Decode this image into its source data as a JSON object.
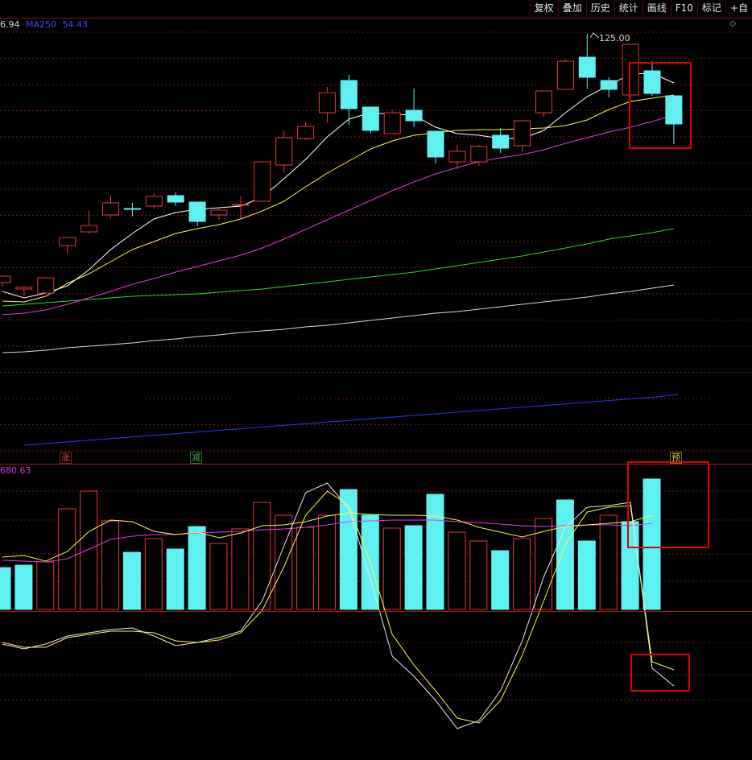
{
  "toolbar": {
    "items": [
      "复权",
      "叠加",
      "历史",
      "统计",
      "画线",
      "F10",
      "标记",
      "+自"
    ]
  },
  "ma_legend": {
    "prev_value": "6.94",
    "ma250_label": "MA250",
    "ma250_value": "54.43"
  },
  "volume_legend": {
    "value": "680.63"
  },
  "price_marker": {
    "high_label": "125.00"
  },
  "event_tags": [
    {
      "text": "涨",
      "color": "#e04040"
    },
    {
      "text": "减",
      "color": "#4caf50"
    },
    {
      "text": "预",
      "color": "#e8c84a"
    }
  ],
  "colors": {
    "up": "#e23a3a",
    "down": "#5ff1f1",
    "ma5": "#ffffff",
    "ma10": "#f6f64a",
    "ma20": "#e23ae2",
    "ma60": "#2ed62e",
    "ma120": "#d8d8d8",
    "ma250": "#2a3af0",
    "highlight_box": "#e00000",
    "grid": "#7a1414"
  },
  "chart_data": {
    "type": "candlestick",
    "candles": [
      {
        "o": 351,
        "c": 343,
        "h": 343,
        "l": 356
      },
      {
        "o": 359,
        "c": 357,
        "h": 355,
        "l": 368
      },
      {
        "o": 364,
        "c": 345,
        "h": 345,
        "l": 364
      },
      {
        "o": 305,
        "c": 295,
        "h": 295,
        "l": 315
      },
      {
        "o": 288,
        "c": 280,
        "h": 262,
        "l": 290
      },
      {
        "o": 267,
        "c": 252,
        "h": 242,
        "l": 271
      },
      {
        "o": 259,
        "c": 259,
        "h": 252,
        "l": 269
      },
      {
        "o": 256,
        "c": 244,
        "h": 240,
        "l": 259
      },
      {
        "o": 243,
        "c": 251,
        "h": 239,
        "l": 256
      },
      {
        "o": 251,
        "c": 275,
        "h": 251,
        "l": 281
      },
      {
        "o": 267,
        "c": 261,
        "h": 258,
        "l": 273
      },
      {
        "o": 255,
        "c": 254,
        "h": 244,
        "l": 271
      },
      {
        "o": 250,
        "c": 201,
        "h": 201,
        "l": 250
      },
      {
        "o": 205,
        "c": 171,
        "h": 162,
        "l": 214
      },
      {
        "o": 172,
        "c": 157,
        "h": 151,
        "l": 174
      },
      {
        "o": 140,
        "c": 115,
        "h": 108,
        "l": 152
      },
      {
        "o": 100,
        "c": 135,
        "h": 93,
        "l": 155
      },
      {
        "o": 133,
        "c": 162,
        "h": 133,
        "l": 166
      },
      {
        "o": 166,
        "c": 140,
        "h": 137,
        "l": 166
      },
      {
        "o": 137,
        "c": 150,
        "h": 110,
        "l": 158
      },
      {
        "o": 163,
        "c": 195,
        "h": 163,
        "l": 203
      },
      {
        "o": 201,
        "c": 188,
        "h": 180,
        "l": 210
      },
      {
        "o": 201,
        "c": 182,
        "h": 180,
        "l": 206
      },
      {
        "o": 168,
        "c": 184,
        "h": 159,
        "l": 190
      },
      {
        "o": 181,
        "c": 150,
        "h": 150,
        "l": 189
      },
      {
        "o": 140,
        "c": 113,
        "h": 113,
        "l": 145
      },
      {
        "o": 111,
        "c": 76,
        "h": 74,
        "l": 111
      },
      {
        "o": 71,
        "c": 96,
        "h": 42,
        "l": 110
      },
      {
        "o": 100,
        "c": 111,
        "h": 96,
        "l": 121
      },
      {
        "o": 118,
        "c": 55,
        "h": 55,
        "l": 122
      },
      {
        "o": 88,
        "c": 116,
        "h": 76,
        "l": 119
      },
      {
        "o": 119,
        "c": 154,
        "h": 119,
        "l": 179
      }
    ],
    "ma5": [
      362,
      370,
      364,
      355,
      335,
      310,
      290,
      272,
      264,
      260,
      258,
      256,
      245,
      222,
      198,
      170,
      148,
      140,
      142,
      143,
      158,
      166,
      168,
      172,
      172,
      162,
      140,
      120,
      106,
      92,
      91,
      103
    ],
    "ma10": [
      374,
      375,
      368,
      352,
      340,
      325,
      310,
      300,
      290,
      284,
      279,
      272,
      262,
      250,
      232,
      215,
      200,
      185,
      175,
      168,
      165,
      162,
      161,
      161,
      160,
      159,
      156,
      149,
      136,
      126,
      122,
      118
    ],
    "ma20": [
      391,
      389,
      385,
      378,
      370,
      362,
      353,
      346,
      338,
      331,
      324,
      317,
      308,
      297,
      285,
      273,
      261,
      249,
      237,
      226,
      216,
      208,
      201,
      196,
      192,
      186,
      178,
      171,
      164,
      158,
      151,
      143
    ],
    "ma60": [
      380,
      378,
      376,
      374,
      372,
      370,
      368,
      367,
      366,
      365,
      363,
      361,
      359,
      356,
      353,
      350,
      347,
      344,
      341,
      338,
      334,
      330,
      326,
      322,
      318,
      313,
      308,
      303,
      297,
      293,
      289,
      284
    ],
    "ma120": [
      438,
      437,
      435,
      432,
      430,
      428,
      426,
      423,
      421,
      418,
      416,
      413,
      411,
      409,
      406,
      404,
      401,
      398,
      395,
      392,
      389,
      387,
      384,
      381,
      378,
      375,
      372,
      369,
      365,
      362,
      358,
      354
    ],
    "ma250": [
      553,
      551,
      549,
      547,
      545,
      543,
      541,
      539,
      537,
      535,
      533,
      531,
      529,
      527,
      525,
      523,
      521,
      519,
      517,
      515,
      513,
      511,
      509,
      507,
      505,
      503,
      501,
      499,
      497,
      495,
      493,
      490
    ],
    "volume": [
      {
        "v": 705,
        "up": false
      },
      {
        "v": 702,
        "up": false
      },
      {
        "v": 698,
        "up": true
      },
      {
        "v": 632,
        "up": true
      },
      {
        "v": 610,
        "up": true
      },
      {
        "v": 647,
        "up": true
      },
      {
        "v": 686,
        "up": false
      },
      {
        "v": 669,
        "up": true
      },
      {
        "v": 682,
        "up": false
      },
      {
        "v": 654,
        "up": false
      },
      {
        "v": 675,
        "up": true
      },
      {
        "v": 657,
        "up": true
      },
      {
        "v": 624,
        "up": true
      },
      {
        "v": 640,
        "up": true
      },
      {
        "v": 655,
        "up": true
      },
      {
        "v": 640,
        "up": true
      },
      {
        "v": 608,
        "up": false
      },
      {
        "v": 640,
        "up": false
      },
      {
        "v": 656,
        "up": true
      },
      {
        "v": 653,
        "up": false
      },
      {
        "v": 614,
        "up": false
      },
      {
        "v": 661,
        "up": true
      },
      {
        "v": 672,
        "up": true
      },
      {
        "v": 684,
        "up": false
      },
      {
        "v": 669,
        "up": true
      },
      {
        "v": 644,
        "up": true
      },
      {
        "v": 621,
        "up": false
      },
      {
        "v": 672,
        "up": false
      },
      {
        "v": 640,
        "up": true
      },
      {
        "v": 648,
        "up": false
      },
      {
        "v": 595,
        "up": false
      }
    ],
    "vol_ma5": [
      692,
      690,
      697,
      685,
      660,
      646,
      648,
      660,
      664,
      661,
      668,
      662,
      653,
      652,
      648,
      641,
      637,
      639,
      640,
      640,
      641,
      646,
      655,
      661,
      667,
      660,
      654,
      652,
      650,
      648,
      640
    ],
    "vol_ma10": [
      696,
      697,
      698,
      694,
      682,
      670,
      666,
      664,
      664,
      662,
      661,
      660,
      658,
      657,
      655,
      652,
      648,
      647,
      646,
      646,
      646,
      648,
      649,
      651,
      653,
      654,
      653,
      652,
      652,
      653,
      650
    ],
    "osc_k": [
      800,
      806,
      800,
      790,
      786,
      782,
      780,
      790,
      802,
      798,
      792,
      784,
      746,
      678,
      612,
      600,
      632,
      720,
      815,
      840,
      870,
      905,
      895,
      858,
      796,
      716,
      655,
      630,
      628,
      624,
      830,
      852
    ],
    "osc_d": [
      798,
      804,
      804,
      792,
      788,
      784,
      784,
      786,
      796,
      798,
      795,
      786,
      758,
      704,
      640,
      610,
      628,
      700,
      788,
      826,
      858,
      892,
      898,
      870,
      814,
      746,
      676,
      636,
      630,
      628,
      822,
      832
    ]
  }
}
